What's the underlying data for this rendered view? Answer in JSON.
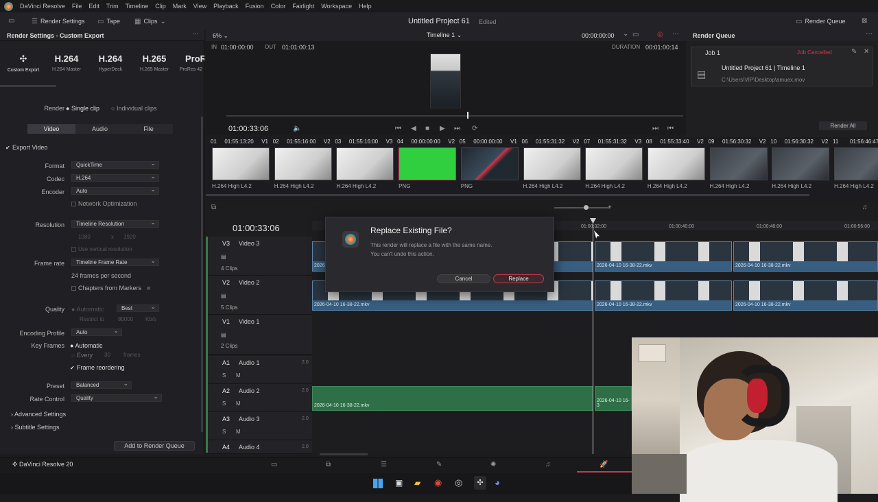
{
  "menubar": {
    "app_name": "DaVinci Resolve",
    "items": [
      "File",
      "Edit",
      "Trim",
      "Timeline",
      "Clip",
      "Mark",
      "View",
      "Playback",
      "Fusion",
      "Color",
      "Fairlight",
      "Workspace",
      "Help"
    ]
  },
  "toolbar": {
    "render_settings": "Render Settings",
    "tape": "Tape",
    "clips": "Clips",
    "project_title": "Untitled Project 61",
    "status": "Edited",
    "render_queue": "Render Queue"
  },
  "render_settings": {
    "header": "Render Settings - Custom Export",
    "presets": [
      {
        "big": "",
        "small": "Custom Export"
      },
      {
        "big": "H.264",
        "small": "H.264 Master"
      },
      {
        "big": "H.264",
        "small": "HyperDeck"
      },
      {
        "big": "H.265",
        "small": "H.265 Master"
      },
      {
        "big": "ProRe",
        "small": "ProRes 42"
      }
    ],
    "render_label": "Render",
    "single_clip": "Single clip",
    "individual_clips": "Individual clips",
    "tabs": [
      "Video",
      "Audio",
      "File"
    ],
    "export_video": "Export Video",
    "format_label": "Format",
    "format_value": "QuickTime",
    "codec_label": "Codec",
    "codec_value": "H.264",
    "encoder_label": "Encoder",
    "encoder_value": "Auto",
    "network_opt": "Network Optimization",
    "resolution_label": "Resolution",
    "resolution_value": "Timeline Resolution",
    "res_w": "1080",
    "res_x": "x",
    "res_h": "1920",
    "use_vertical": "Use vertical resolution",
    "framerate_label": "Frame rate",
    "framerate_value": "Timeline Frame Rate",
    "fps_text": "24 frames per second",
    "chapters": "Chapters from Markers",
    "quality_label": "Quality",
    "quality_auto": "Automatic",
    "quality_value": "Best",
    "restrict_to": "Restrict to",
    "restrict_value": "80000",
    "restrict_unit": "Kb/s",
    "encoding_profile_label": "Encoding Profile",
    "encoding_profile_value": "Auto",
    "keyframes_label": "Key Frames",
    "keyframes_auto": "Automatic",
    "every": "Every",
    "every_value": "30",
    "frames": "frames",
    "frame_reordering": "Frame reordering",
    "preset_label": "Preset",
    "preset_value": "Balanced",
    "rate_control_label": "Rate Control",
    "rate_control_value": "Quality",
    "advanced": "Advanced Settings",
    "subtitle": "Subtitle Settings",
    "add_to_queue": "Add to Render Queue"
  },
  "viewer": {
    "zoom": "6%",
    "timeline_name": "Timeline 1",
    "timecode_top": "00:00:00:00",
    "in_label": "IN",
    "in_value": "01:00:00:00",
    "out_label": "OUT",
    "out_value": "01:01:00:13",
    "duration_label": "DURATION",
    "duration_value": "00:01:00:14",
    "current_tc": "01:00:33:06"
  },
  "render_queue": {
    "job_label": "Job 1",
    "job_status": "Job Cancelled",
    "job_title": "Untitled Project 61 | Timeline 1",
    "job_path": "C:\\Users\\VIP\\Desktop\\amuex.mov",
    "render_all": "Render All"
  },
  "clips": [
    {
      "num": "01",
      "tc": "01:55:13:20",
      "track": "V1",
      "codec": "H.264 High L4.2"
    },
    {
      "num": "02",
      "tc": "01:55:16:00",
      "track": "V2",
      "codec": "H.264 High L4.2"
    },
    {
      "num": "03",
      "tc": "01:55:16:00",
      "track": "V3",
      "codec": "H.264 High L4.2"
    },
    {
      "num": "04",
      "tc": "00:00:00:00",
      "track": "V2",
      "codec": "PNG"
    },
    {
      "num": "05",
      "tc": "00:00:00:00",
      "track": "V1",
      "codec": "PNG"
    },
    {
      "num": "06",
      "tc": "01:55:31:32",
      "track": "V2",
      "codec": "H.264 High L4.2"
    },
    {
      "num": "07",
      "tc": "01:55:31:32",
      "track": "V3",
      "codec": "H.264 High L4.2"
    },
    {
      "num": "08",
      "tc": "01:55:33:40",
      "track": "V2",
      "codec": "H.264 High L4.2"
    },
    {
      "num": "09",
      "tc": "01:56:30:32",
      "track": "V2",
      "codec": "H.264 High L4.2"
    },
    {
      "num": "10",
      "tc": "01:56:30:32",
      "track": "V2",
      "codec": "H.264 High L4.2"
    },
    {
      "num": "11",
      "tc": "01:56:46:47",
      "track": "",
      "codec": "H.264 High L4.2"
    }
  ],
  "timeline": {
    "timecode": "01:00:33:06",
    "ruler": [
      "01:00:32:00",
      "01:00:40:00",
      "01:00:48:00",
      "01:00:56:00"
    ],
    "tracks": [
      {
        "id": "V3",
        "name": "Video 3",
        "count": "4 Clips"
      },
      {
        "id": "V2",
        "name": "Video 2",
        "count": "5 Clips"
      },
      {
        "id": "V1",
        "name": "Video 1",
        "count": "2 Clips"
      },
      {
        "id": "A1",
        "name": "Audio 1",
        "level": "2.0"
      },
      {
        "id": "A2",
        "name": "Audio 2",
        "level": "2.0"
      },
      {
        "id": "A3",
        "name": "Audio 3",
        "level": "2.0"
      },
      {
        "id": "A4",
        "name": "Audio 4",
        "level": "2.0"
      }
    ],
    "clip_name": "2026-04-10 16-38-22.mkv",
    "clip_name_short": "2026-04-10 16-3"
  },
  "dialog": {
    "title": "Replace Existing File?",
    "message": "This render will replace a file with the same name. You can't undo this action.",
    "cancel": "Cancel",
    "replace": "Replace"
  },
  "footer": {
    "app_version": "DaVinci Resolve 20"
  },
  "colors": {
    "accent_red": "#d2354a",
    "video_clip": "#385f82",
    "audio_clip": "#2f6f48"
  }
}
